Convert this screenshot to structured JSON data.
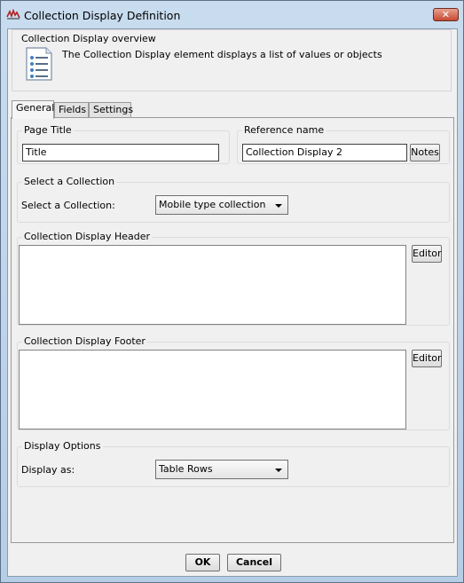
{
  "window": {
    "title": "Collection Display Definition",
    "close_glyph": "✕"
  },
  "overview": {
    "title": "Collection Display overview",
    "description": "The Collection Display element displays a list of values or objects"
  },
  "tabs": [
    {
      "label": "General",
      "active": true
    },
    {
      "label": "Fields",
      "active": false
    },
    {
      "label": "Settings",
      "active": false
    }
  ],
  "general": {
    "page_title": {
      "label": "Page Title",
      "value": "Title"
    },
    "reference_name": {
      "label": "Reference name",
      "value": "Collection Display 2",
      "notes_button": "Notes"
    },
    "select_collection": {
      "group_label": "Select a Collection",
      "field_label": "Select a Collection:",
      "selected": "Mobile type collection"
    },
    "header": {
      "label": "Collection Display Header",
      "editor_button": "Editor"
    },
    "footer": {
      "label": "Collection Display Footer",
      "editor_button": "Editor"
    },
    "display_options": {
      "group_label": "Display Options",
      "field_label": "Display as:",
      "selected": "Table Rows"
    }
  },
  "footer_buttons": {
    "ok": "OK",
    "cancel": "Cancel"
  },
  "icons": {
    "app": "app-logo-icon",
    "overview": "document-list-icon",
    "close": "close-icon",
    "dropdown": "chevron-down-icon"
  },
  "colors": {
    "close_button": "#c74a33",
    "titlebar": "#c9dcef"
  }
}
